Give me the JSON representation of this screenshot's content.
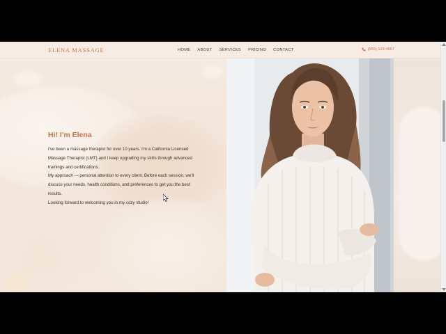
{
  "header": {
    "logo": "ELENA MASSAGE",
    "nav": [
      "HOME",
      "ABOUT",
      "SERVICES",
      "PRICING",
      "CONTACT"
    ],
    "phone": "(555) 123-4567",
    "phone_icon": "phone-icon"
  },
  "intro": {
    "heading": "Hi! I'm Elena",
    "lines": [
      "I've been a massage therapist for over 10 years. I'm a California Licensed",
      "Massage Therapist (LMT) and I keep upgrading my skills through advanced",
      "trainings and certifications.",
      "My approach — personal attention to every client. Before each session, we'll",
      "discuss your needs, health conditions, and preferences to get you the best",
      "results.",
      "Looking forward to welcoming you in my cozy studio!"
    ]
  },
  "colors": {
    "accent": "#c8734a",
    "background": "#f7ece2",
    "text": "#3d3029"
  }
}
